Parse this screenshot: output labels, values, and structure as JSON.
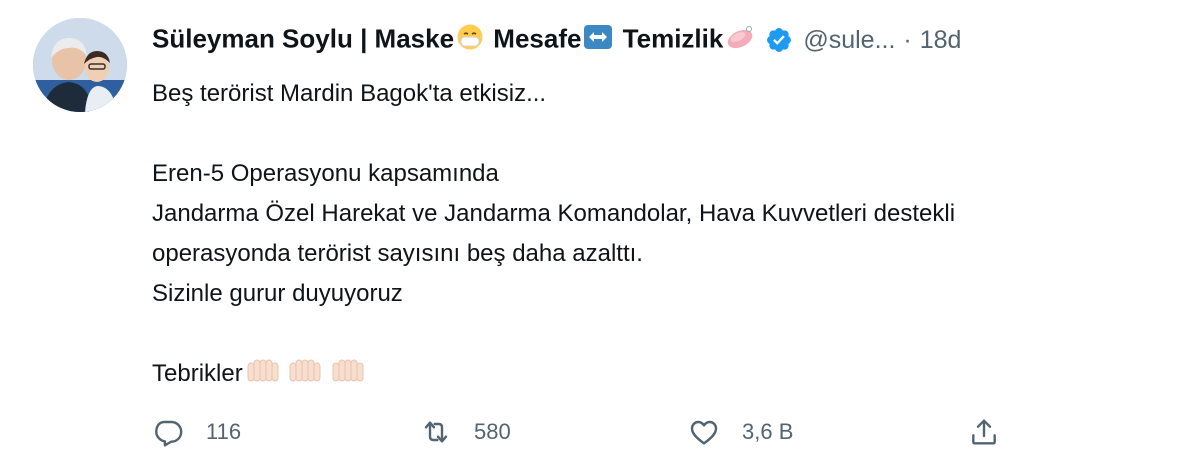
{
  "tweet": {
    "author": {
      "display_name_parts": [
        "Süleyman Soylu | Maske",
        " Mesafe",
        " Temizlik"
      ],
      "handle": "@sule...",
      "time": "18d",
      "separator": "·",
      "verified": true,
      "emojis": [
        "mask-emoji",
        "left-right-arrow-emoji",
        "soap-emoji"
      ]
    },
    "text_lines": [
      "Beş terörist Mardin Bagok'ta etkisiz...",
      "",
      "Eren-5 Operasyonu kapsamında",
      "Jandarma Özel Harekat ve Jandarma Komandolar, Hava Kuvvetleri destekli",
      "operasyonda terörist sayısını beş daha azalttı.",
      "Sizinle gurur duyuyoruz",
      "",
      "Tebrikler"
    ],
    "actions": {
      "reply_count": "116",
      "retweet_count": "580",
      "like_count": "3,6 B"
    },
    "colors": {
      "text": "#0f1419",
      "secondary": "#536471",
      "verified": "#1d9bf0"
    }
  }
}
